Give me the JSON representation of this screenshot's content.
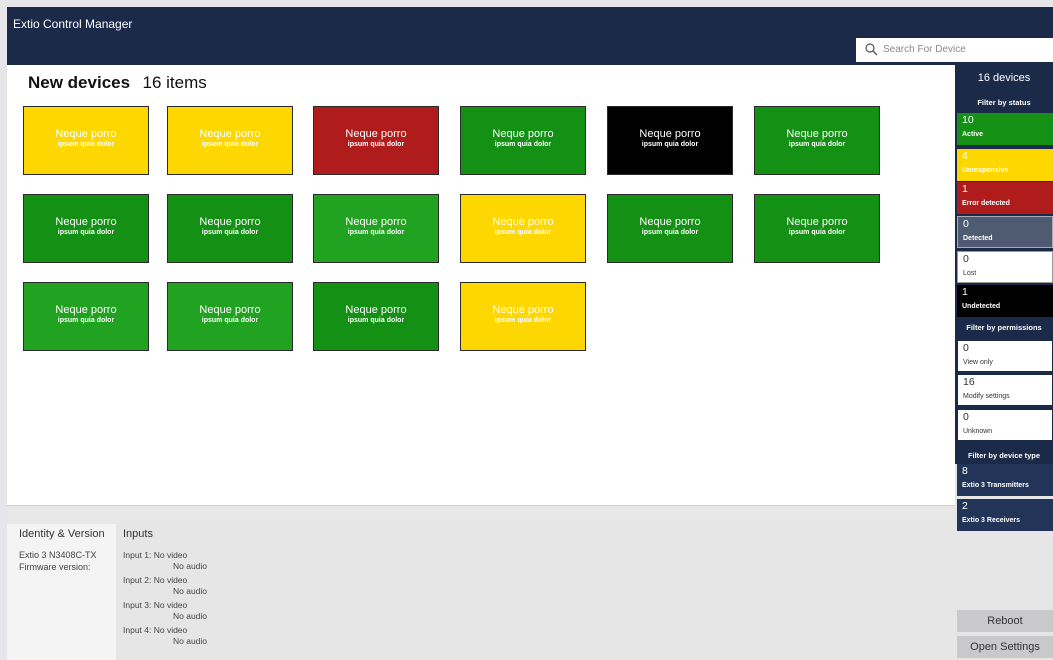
{
  "app": {
    "title": "Extio Control Manager"
  },
  "search": {
    "placeholder": "Search For Device"
  },
  "main": {
    "title": "New devices",
    "count": "16 items",
    "devices": [
      {
        "name": "Neque porro",
        "desc": "ipsum quia dolor",
        "status_color": "#ffd700"
      },
      {
        "name": "Neque porro",
        "desc": "ipsum quia dolor",
        "status_color": "#ffd700"
      },
      {
        "name": "Neque porro",
        "desc": "ipsum quia dolor",
        "status_color": "#b01c1c"
      },
      {
        "name": "Neque porro",
        "desc": "ipsum quia dolor",
        "status_color": "#149014"
      },
      {
        "name": "Neque porro",
        "desc": "ipsum quia dolor",
        "status_color": "#000000"
      },
      {
        "name": "Neque porro",
        "desc": "ipsum quia dolor",
        "status_color": "#149014"
      },
      {
        "name": "Neque porro",
        "desc": "ipsum quia dolor",
        "status_color": "#149014"
      },
      {
        "name": "Neque porro",
        "desc": "ipsum quia dolor",
        "status_color": "#149014"
      },
      {
        "name": "Neque porro",
        "desc": "ipsum quia dolor",
        "status_color": "#21a321"
      },
      {
        "name": "Neque porro",
        "desc": "ipsum quia dolor",
        "status_color": "#ffd700"
      },
      {
        "name": "Neque porro",
        "desc": "ipsum quia dolor",
        "status_color": "#149014"
      },
      {
        "name": "Neque porro",
        "desc": "ipsum quia dolor",
        "status_color": "#149014"
      },
      {
        "name": "Neque porro",
        "desc": "ipsum quia dolor",
        "status_color": "#21a321"
      },
      {
        "name": "Neque porro",
        "desc": "ipsum quia dolor",
        "status_color": "#21a321"
      },
      {
        "name": "Neque porro",
        "desc": "ipsum quia dolor",
        "status_color": "#149014"
      },
      {
        "name": "Neque porro",
        "desc": "ipsum quia dolor",
        "status_color": "#ffd700"
      }
    ]
  },
  "identity": {
    "title": "Identity & Version",
    "model": "Extio 3 N3408C-TX",
    "firmware_label": "Firmware version:"
  },
  "inputs": {
    "title": "Inputs",
    "items": [
      {
        "video": "Input 1: No video",
        "audio": "No audio"
      },
      {
        "video": "Input 2: No video",
        "audio": "No audio"
      },
      {
        "video": "Input 3: No video",
        "audio": "No audio"
      },
      {
        "video": "Input 4: No video",
        "audio": "No audio"
      }
    ]
  },
  "sidebar": {
    "count": "16 devices",
    "status_title": "Filter by status",
    "status_filters": [
      {
        "count": "10",
        "label": "Active",
        "color": "#149014"
      },
      {
        "count": "4",
        "label": "Unresponsive",
        "color": "#ffd700"
      },
      {
        "count": "1",
        "label": "Error detected",
        "color": "#b01c1c"
      },
      {
        "count": "0",
        "label": "Detected",
        "color": "#4f5b70"
      },
      {
        "count": "0",
        "label": "Lost",
        "color": "#ffffff"
      },
      {
        "count": "1",
        "label": "Undetected",
        "color": "#000000"
      }
    ],
    "permissions_title": "Filter by permissions",
    "permission_filters": [
      {
        "count": "0",
        "label": "View only"
      },
      {
        "count": "16",
        "label": "Modify settings"
      },
      {
        "count": "0",
        "label": "Unknown"
      }
    ],
    "type_title": "Filter by device type",
    "type_filters": [
      {
        "count": "8",
        "label": "Extio 3 Transmitters"
      },
      {
        "count": "2",
        "label": "Extio 3 Receivers"
      }
    ],
    "reboot_label": "Reboot",
    "settings_label": "Open Settings"
  }
}
